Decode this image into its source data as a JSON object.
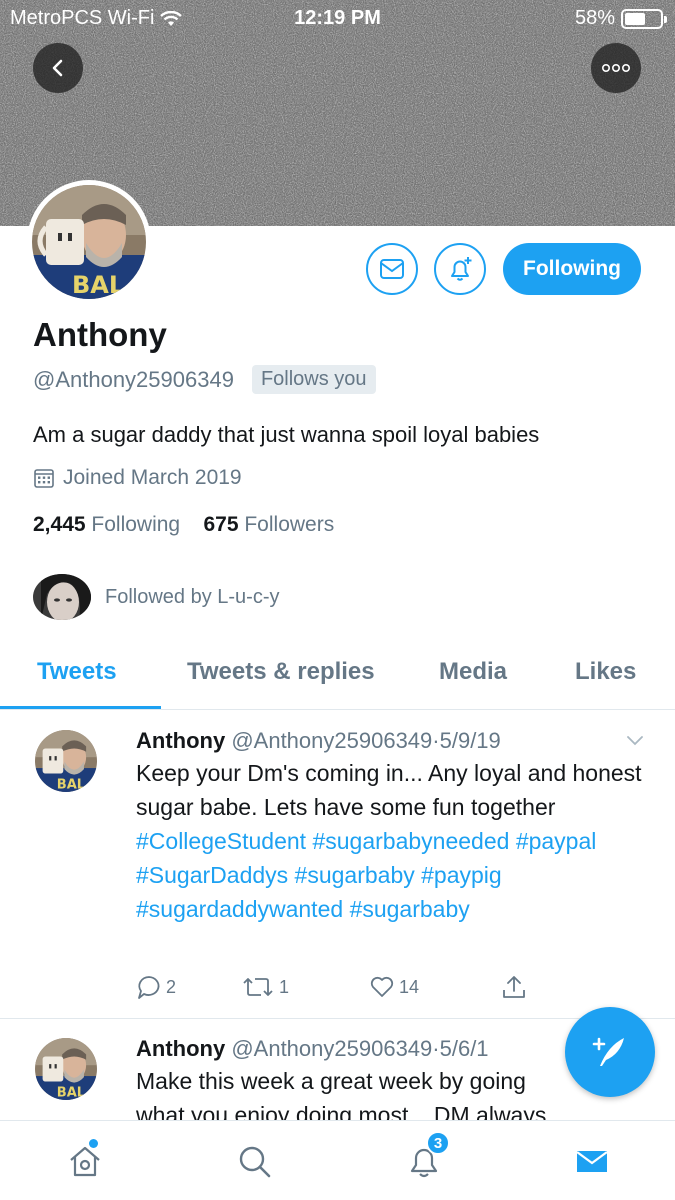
{
  "status_bar": {
    "carrier": "MetroPCS Wi-Fi",
    "time": "12:19 PM",
    "battery": "58%"
  },
  "profile": {
    "name": "Anthony",
    "handle": "@Anthony25906349",
    "follows_you": "Follows you",
    "bio": "Am a sugar daddy that just wanna spoil loyal babies",
    "joined": "Joined March 2019",
    "following_count": "2,445",
    "following_label": "Following",
    "followers_count": "675",
    "followers_label": "Followers",
    "followed_by": "Followed by L-u-c-y"
  },
  "actions": {
    "following_button": "Following"
  },
  "tabs": [
    {
      "label": "Tweets",
      "active": true
    },
    {
      "label": "Tweets & replies",
      "active": false
    },
    {
      "label": "Media",
      "active": false
    },
    {
      "label": "Likes",
      "active": false
    }
  ],
  "tweets": [
    {
      "name": "Anthony",
      "handle": "@Anthony25906349",
      "date": "5/9/19",
      "text": "Keep your Dm's coming in... Any loyal and honest sugar babe. Lets have some fun together",
      "hashtags": [
        "#CollegeStudent",
        "#sugarbabyneeded",
        "#paypal",
        "#SugarDaddys",
        "#sugarbaby",
        "#paypig",
        "#sugardaddywanted",
        "#sugarbaby"
      ],
      "replies": "2",
      "retweets": "1",
      "likes": "14"
    },
    {
      "name": "Anthony",
      "handle": "@Anthony25906349",
      "date": "5/6/1",
      "text_line1": "Make this week a great week by going",
      "text_line2": "what you enjoy doing most... DM always"
    }
  ],
  "bottom_nav": {
    "notifications_badge": "3"
  },
  "colors": {
    "accent": "#1da1f2",
    "secondary_text": "#657786"
  }
}
